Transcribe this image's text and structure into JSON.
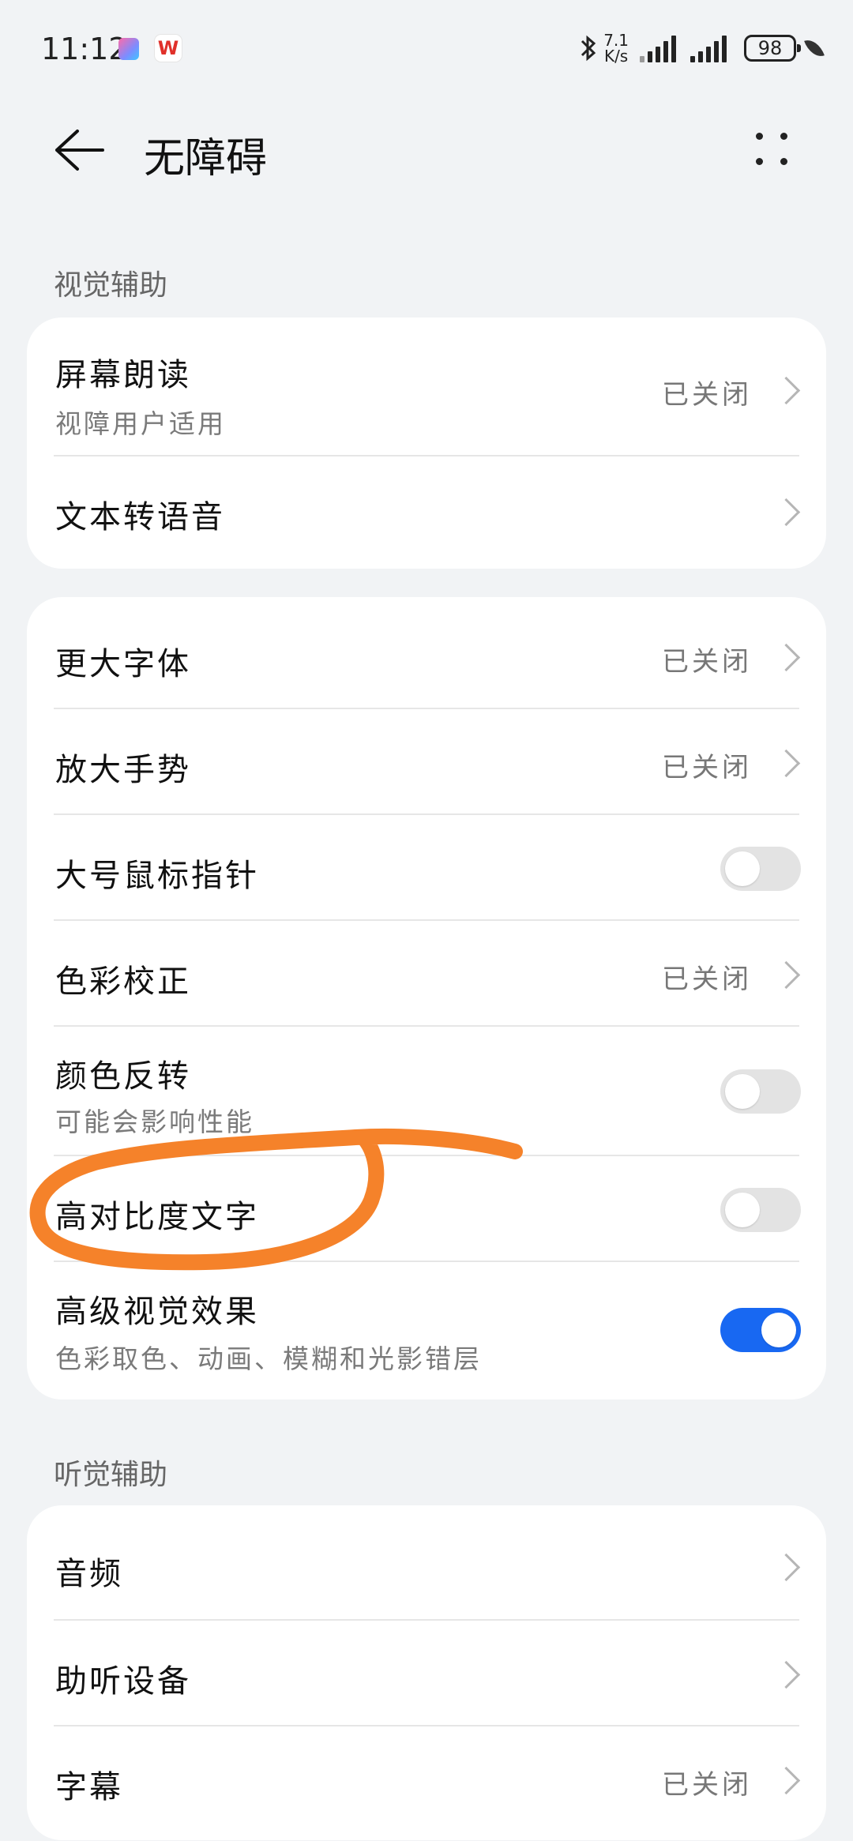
{
  "status_bar": {
    "time": "11:12",
    "net_speed_value": "7.1",
    "net_speed_unit": "K/s",
    "battery": "98",
    "icons": [
      "app-icon",
      "wps-icon",
      "bluetooth-icon",
      "signal-icon",
      "signal-icon",
      "battery-icon",
      "leaf-icon"
    ],
    "wps_letter": "W"
  },
  "header": {
    "title": "无障碍",
    "back_icon": "back-arrow-icon",
    "more_icon": "more-icon"
  },
  "sections": {
    "visual_label": "视觉辅助",
    "hearing_label": "听觉辅助"
  },
  "card1": {
    "screen_reader": {
      "label": "屏幕朗读",
      "sub": "视障用户适用",
      "status": "已关闭"
    },
    "tts": {
      "label": "文本转语音"
    }
  },
  "card2": {
    "larger_font": {
      "label": "更大字体",
      "status": "已关闭"
    },
    "magnify": {
      "label": "放大手势",
      "status": "已关闭"
    },
    "large_pointer": {
      "label": "大号鼠标指针",
      "toggle": "off"
    },
    "color_correction": {
      "label": "色彩校正",
      "status": "已关闭"
    },
    "color_inversion": {
      "label": "颜色反转",
      "sub": "可能会影响性能",
      "toggle": "off"
    },
    "high_contrast": {
      "label": "高对比度文字",
      "toggle": "off"
    },
    "advanced_visual": {
      "label": "高级视觉效果",
      "sub": "色彩取色、动画、模糊和光影错层",
      "toggle": "on"
    }
  },
  "card3": {
    "audio": {
      "label": "音频"
    },
    "hearing_aid": {
      "label": "助听设备"
    },
    "captions": {
      "label": "字幕",
      "status": "已关闭"
    }
  },
  "colors": {
    "accent": "#1868f2",
    "annotation": "#f5822a",
    "background": "#f1f3f5"
  }
}
